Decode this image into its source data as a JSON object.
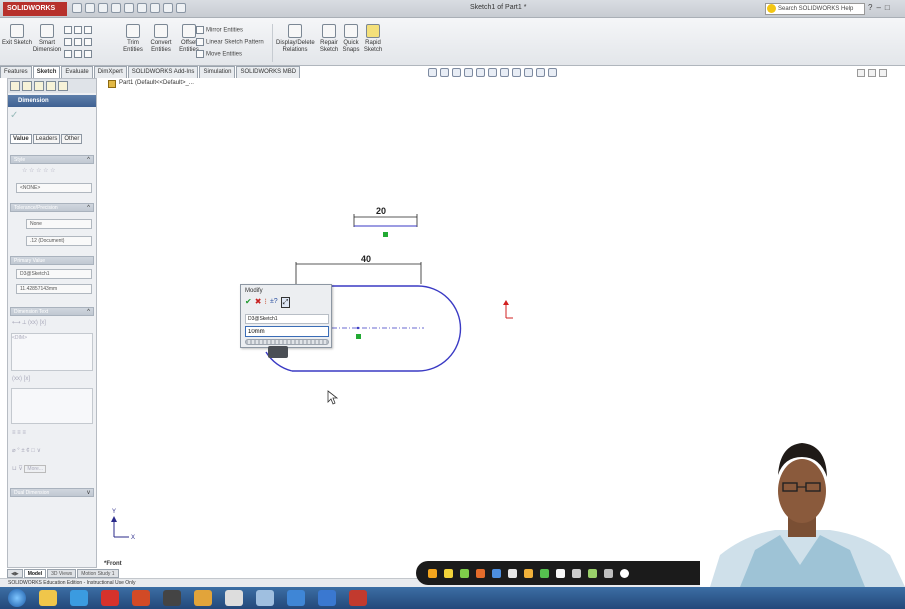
{
  "titlebar": {
    "app_name": "SOLIDWORKS",
    "document_title": "Sketch1 of Part1 *",
    "help_search_placeholder": "Search SOLIDWORKS Help"
  },
  "command_manager": {
    "exit_sketch": "Exit Sketch",
    "smart_dimension": "Smart Dimension",
    "trim_entities": "Trim Entities",
    "convert_entities": "Convert Entities",
    "offset_entities": "Offset Entities",
    "mirror_entities": "Mirror Entities",
    "linear_sketch_pattern": "Linear Sketch Pattern",
    "move_entities": "Move Entities",
    "display_delete_relations": "Display/Delete Relations",
    "repair_sketch": "Repair Sketch",
    "quick_snaps": "Quick Snaps",
    "rapid_sketch": "Rapid Sketch"
  },
  "tabs": [
    "Features",
    "Sketch",
    "Evaluate",
    "DimXpert",
    "SOLIDWORKS Add-Ins",
    "Simulation",
    "SOLIDWORKS MBD"
  ],
  "active_tab": "Sketch",
  "feature_tree": {
    "item": "Part1  (Default<<Default>_..."
  },
  "property_manager": {
    "title": "Dimension",
    "tabs": [
      "Value",
      "Leaders",
      "Other"
    ],
    "style_group": "Style",
    "style_value": "<NONE>",
    "tolerance_group": "Tolerance/Precision",
    "tolerance_value": "None",
    "precision_value": ".12 (Document)",
    "primary_value_group": "Primary Value",
    "primary_name": "D3@Sketch1",
    "primary_value": "11.42857143mm",
    "dimension_text_group": "Dimension Text",
    "dimension_text_var": "<DIM>",
    "more_label": "More...",
    "dual_dimension": "Dual Dimension"
  },
  "drawing": {
    "dim_top": "20",
    "dim_middle": "40"
  },
  "modify_dialog": {
    "title": "Modify",
    "dimension_name": "D3@Sketch1",
    "value": "10mm"
  },
  "view_label": "*Front",
  "bottom_tabs": [
    "Model",
    "3D Views",
    "Motion Study 1"
  ],
  "active_bottom_tab": "Model",
  "status_bar": "SOLIDWORKS Education Edition - Instructional Use Only",
  "colors": {
    "sketch_line": "#3a3ac4",
    "centerline": "#3a3ac4",
    "dimension": "#222222",
    "origin": "#d22020",
    "axis_y": "#2a2a8a",
    "relation_marker": "#22aa33"
  }
}
